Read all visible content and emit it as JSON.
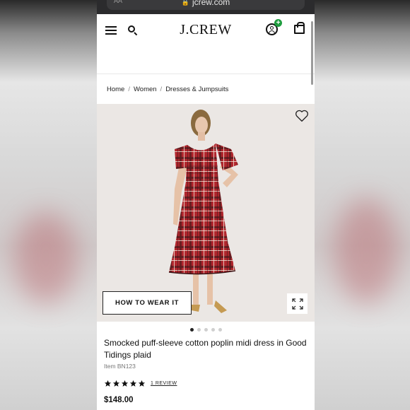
{
  "browser": {
    "url": "jcrew.com",
    "text_size_label": "AA"
  },
  "header": {
    "logo": "J.CREW",
    "badge": "+"
  },
  "breadcrumb": {
    "items": [
      "Home",
      "Women",
      "Dresses & Jumpsuits"
    ],
    "separator": "/"
  },
  "hero": {
    "how_to_label": "HOW TO WEAR IT",
    "slides_total": 5,
    "slides_active": 1
  },
  "product": {
    "title": "Smocked puff-sleeve cotton poplin midi dress in Good Tidings plaid",
    "item_number": "Item BN123",
    "rating": 5,
    "review_label": "1 REVIEW",
    "price": "$148.00"
  },
  "colors": {
    "accent_green": "#1f9d3f",
    "plaid_red": "#b0262d",
    "plaid_dark": "#2a1618"
  }
}
